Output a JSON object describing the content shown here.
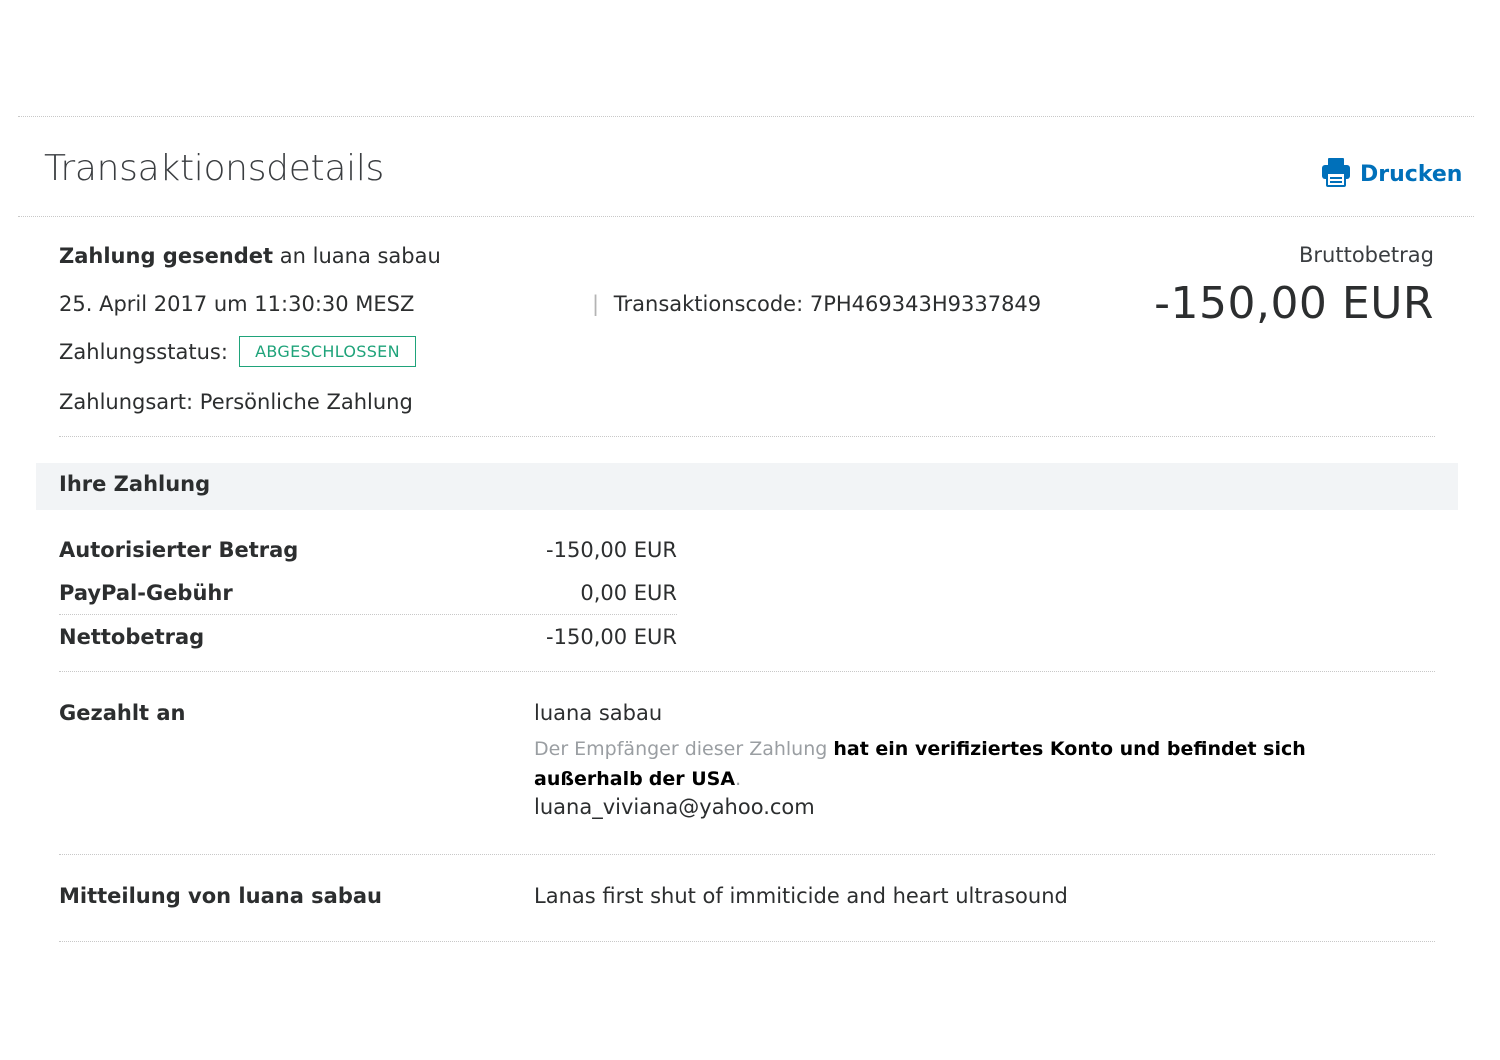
{
  "header": {
    "title": "Transaktionsdetails",
    "print_label": "Drucken",
    "print_icon": "printer-icon"
  },
  "summary": {
    "sent_label": "Zahlung gesendet",
    "sent_to": "an luana sabau",
    "date": "25. April 2017 um 11:30:30 MESZ",
    "separator": "|",
    "transaction_code": "Transaktionscode: 7PH469343H9337849",
    "status_label": "Zahlungsstatus:",
    "status_value": "ABGESCHLOSSEN",
    "type": "Zahlungsart: Persönliche Zahlung",
    "gross_label": "Bruttobetrag",
    "gross_value": "-150,00 EUR"
  },
  "payment": {
    "title": "Ihre Zahlung",
    "rows": [
      {
        "label": "Autorisierter Betrag",
        "value": "-150,00 EUR"
      },
      {
        "label": "PayPal-Gebühr",
        "value": "0,00 EUR"
      },
      {
        "label": "Nettobetrag",
        "value": "-150,00 EUR"
      }
    ]
  },
  "paid_to": {
    "label": "Gezahlt an",
    "name": "luana sabau",
    "note_gray": "Der Empfänger dieser Zahlung",
    "note_bold_1": "hat ein verifiziertes Konto und befindet sich außerhalb",
    "note_bold_2": "der USA",
    "note_end": ".",
    "email": "luana_viviana@yahoo.com"
  },
  "message": {
    "label": "Mitteilung von luana sabau",
    "text": "Lanas first shut of immiticide and heart ultrasound"
  },
  "colors": {
    "accent": "#0070ba",
    "status": "#1fa37a",
    "band": "#f2f4f6"
  }
}
